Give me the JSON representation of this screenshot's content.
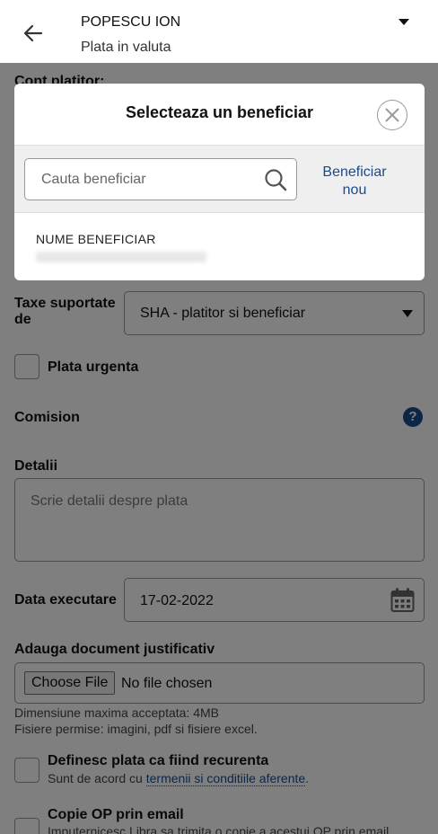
{
  "header": {
    "account_name": "POPESCU ION",
    "subtitle": "Plata in valuta"
  },
  "form": {
    "payer_account_label": "Cont platitor:",
    "fees_label_line1": "Taxe suportate",
    "fees_label_line2": "de",
    "fees_value": "SHA - platitor si beneficiar",
    "urgent_label": "Plata urgenta",
    "commission_label": "Comision",
    "details_label": "Detalii",
    "details_placeholder": "Scrie detalii despre plata",
    "exec_date_label": "Data executare",
    "exec_date_value": "17-02-2022",
    "doc_label": "Adauga document justificativ",
    "file_button": "Choose File",
    "file_status": "No file chosen",
    "size_hint": "Dimensiune maxima acceptata: 4MB",
    "types_hint": "Fisiere permise: imagini, pdf si fisiere excel.",
    "recurrent_label": "Definesc plata ca fiind recurenta",
    "recurrent_sub_prefix": "Sunt de acord cu ",
    "recurrent_sub_link": "termenii si conditiile aferente",
    "recurrent_sub_suffix": ".",
    "copy_label": "Copie OP prin email",
    "copy_sub": "Imputernicesc Libra sa trimita o copie a acestui OP prin email"
  },
  "modal": {
    "title": "Selecteaza un beneficiar",
    "search_placeholder": "Cauta beneficiar",
    "new_beneficiary_line1": "Beneficiar",
    "new_beneficiary_line2": "nou",
    "beneficiary_name": "NUME BENEFICIAR"
  },
  "colors": {
    "link_blue": "#1a4b8c",
    "overlay": "rgba(0,0,0,0.5)"
  }
}
